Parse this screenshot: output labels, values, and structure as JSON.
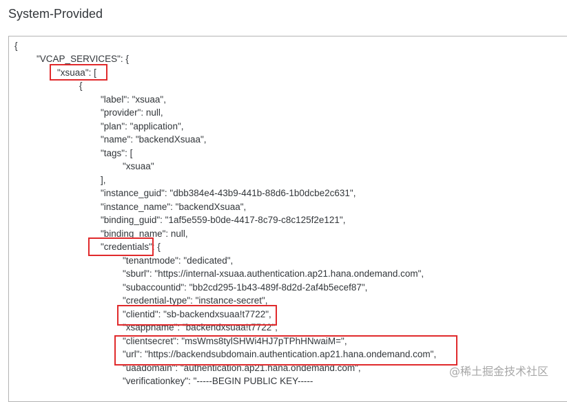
{
  "section_title": "System-Provided",
  "code_lines": [
    {
      "text": "{"
    },
    {
      "text": "\"VCAP_SERVICES\": {"
    },
    {
      "text": "\"xsuaa\": ["
    },
    {
      "text": "{"
    },
    {
      "text": "\"label\": \"xsuaa\","
    },
    {
      "text": "\"provider\": null,"
    },
    {
      "text": "\"plan\": \"application\","
    },
    {
      "text": "\"name\": \"backendXsuaa\","
    },
    {
      "text": "\"tags\": ["
    },
    {
      "text": "\"xsuaa\""
    },
    {
      "text": "],"
    },
    {
      "text": "\"instance_guid\": \"dbb384e4-43b9-441b-88d6-1b0dcbe2c631\","
    },
    {
      "text": "\"instance_name\": \"backendXsuaa\","
    },
    {
      "text": "\"binding_guid\": \"1af5e559-b0de-4417-8c79-c8c125f2e121\","
    },
    {
      "text": "\"binding_name\": null,"
    },
    {
      "text": "\"credentials\": {"
    },
    {
      "text": "\"tenantmode\": \"dedicated\","
    },
    {
      "text": "\"sburl\": \"https://internal-xsuaa.authentication.ap21.hana.ondemand.com\","
    },
    {
      "text": "\"subaccountid\": \"bb2cd295-1b43-489f-8d2d-2af4b5ecef87\","
    },
    {
      "text": "\"credential-type\": \"instance-secret\","
    },
    {
      "text": "\"clientid\": \"sb-backendxsuaa!t7722\","
    },
    {
      "text": "\"xsappname\": \"backendxsuaa!t7722\","
    },
    {
      "text": "\"clientsecret\": \"msWms8tylSHWi4HJ7pTPhHNwaiM=\","
    },
    {
      "text": "\"url\": \"https://backendsubdomain.authentication.ap21.hana.ondemand.com\","
    },
    {
      "text": "\"uaadomain\": \"authentication.ap21.hana.ondemand.com\","
    },
    {
      "text": "\"verificationkey\": \"-----BEGIN PUBLIC KEY-----"
    }
  ],
  "watermark": "@稀土掘金技术社区"
}
